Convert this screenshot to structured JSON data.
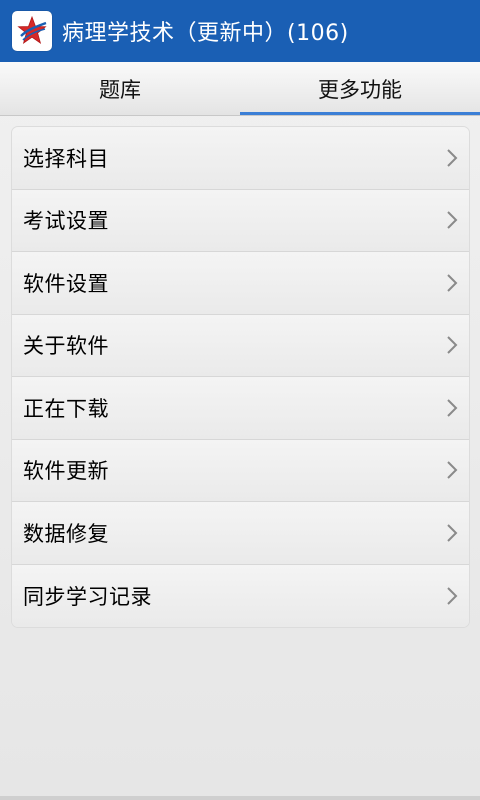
{
  "app_bar": {
    "title": "病理学技术（更新中）(106)",
    "icon": "app-star-icon",
    "bar_color": "#1a5fb4"
  },
  "tabs": [
    {
      "label": "题库",
      "active": false
    },
    {
      "label": "更多功能",
      "active": true
    }
  ],
  "menu": {
    "items": [
      {
        "label": "选择科目"
      },
      {
        "label": "考试设置"
      },
      {
        "label": "软件设置"
      },
      {
        "label": "关于软件"
      },
      {
        "label": "正在下载"
      },
      {
        "label": "软件更新"
      },
      {
        "label": "数据修复"
      },
      {
        "label": "同步学习记录"
      }
    ],
    "chevron_icon": "chevron-right-icon"
  },
  "colors": {
    "accent": "#3b7fd6",
    "background": "#eeeeee"
  }
}
